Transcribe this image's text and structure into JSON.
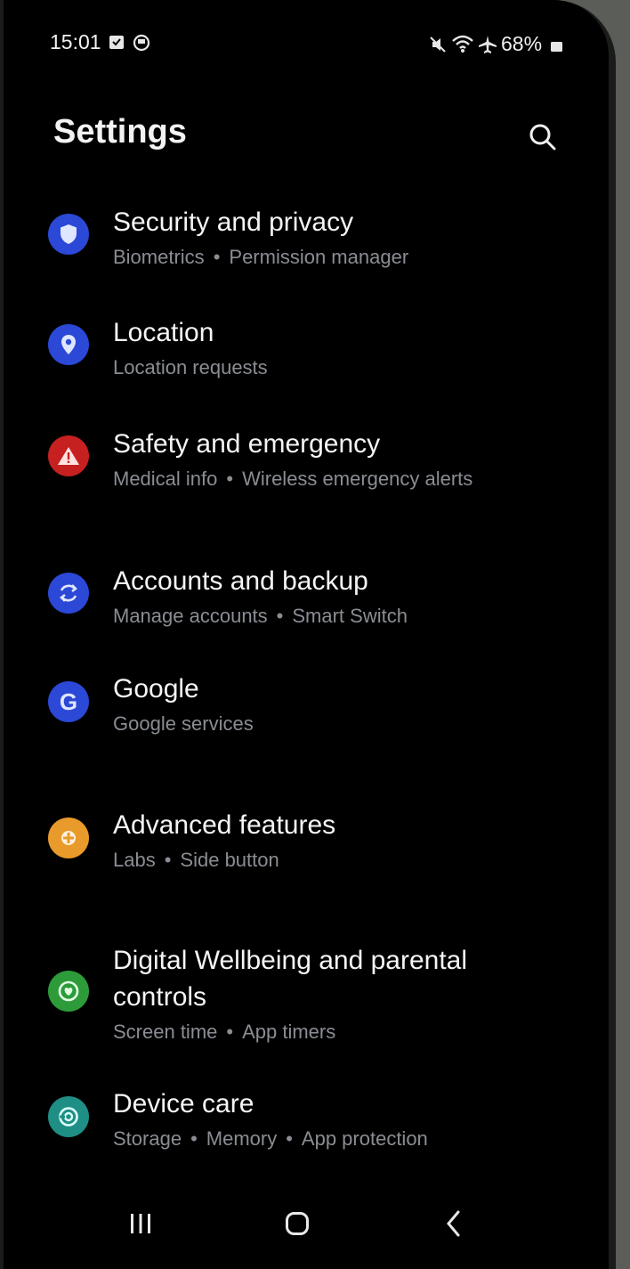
{
  "status": {
    "time": "15:01",
    "battery": "68%"
  },
  "header": {
    "title": "Settings"
  },
  "items": [
    {
      "title": "Security and privacy",
      "sub": [
        "Biometrics",
        "Permission manager"
      ],
      "icon": "shield-icon",
      "color": "#2b48d6"
    },
    {
      "title": "Location",
      "sub": [
        "Location requests"
      ],
      "icon": "location-pin-icon",
      "color": "#2b48d6"
    },
    {
      "title": "Safety and emergency",
      "sub": [
        "Medical info",
        "Wireless emergency alerts"
      ],
      "icon": "warning-icon",
      "color": "#c62020"
    },
    {
      "title": "Accounts and backup",
      "sub": [
        "Manage accounts",
        "Smart Switch"
      ],
      "icon": "sync-icon",
      "color": "#2b48d6"
    },
    {
      "title": "Google",
      "sub": [
        "Google services"
      ],
      "icon": "google-icon",
      "color": "#2b48d6"
    },
    {
      "title": "Advanced features",
      "sub": [
        "Labs",
        "Side button"
      ],
      "icon": "puzzle-icon",
      "color": "#e89a2a"
    },
    {
      "title_line1": "Digital Wellbeing and parental",
      "title_line2": "controls",
      "sub": [
        "Screen time",
        "App timers"
      ],
      "icon": "wellbeing-icon",
      "color": "#2d9b3a"
    },
    {
      "title": "Device care",
      "sub": [
        "Storage",
        "Memory",
        "App protection"
      ],
      "icon": "device-care-icon",
      "color": "#1f8f86"
    }
  ],
  "colors": {
    "background": "#000000",
    "subtitle": "#8a8d93",
    "blue_icon": "#2b48d6",
    "red_icon": "#c62020",
    "orange_icon": "#e89a2a",
    "green_icon": "#2d9b3a",
    "teal_icon": "#1f8f86"
  }
}
